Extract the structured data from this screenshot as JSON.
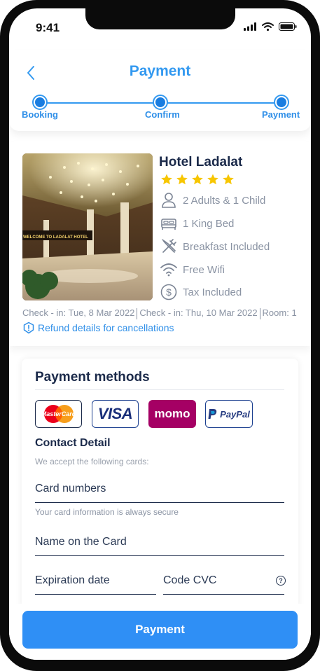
{
  "status_bar": {
    "time": "9:41"
  },
  "header": {
    "title": "Payment"
  },
  "steps": [
    {
      "label": "Booking"
    },
    {
      "label": "Confirm"
    },
    {
      "label": "Payment"
    }
  ],
  "hotel": {
    "name": "Hotel Ladalat",
    "rating": 5,
    "photo_sign": "WELCOME TO LADALAT HOTEL",
    "amenities": {
      "guests": "2 Adults & 1 Child",
      "bed": "1 King Bed",
      "breakfast": "Breakfast Included",
      "wifi": "Free Wifi",
      "tax": "Tax Included"
    },
    "check_in": "Check - in: Tue, 8 Mar 2022",
    "check_out": "Check - in: Thu, 10 Mar 2022",
    "room": "Room: 1",
    "refund_link": "Refund details for cancellations"
  },
  "payment_methods": {
    "title": "Payment methods",
    "options": [
      {
        "name": "MasterCard"
      },
      {
        "name": "VISA"
      },
      {
        "name": "momo"
      },
      {
        "name": "PayPal"
      }
    ]
  },
  "contact": {
    "title": "Contact Detail",
    "subtitle": "We accept the following cards:",
    "card_number_label": "Card numbers",
    "card_hint": "Your card information is always secure",
    "name_label": "Name on the Card",
    "expiration_label": "Expiration date",
    "cvc_label": "Code CVC"
  },
  "submit": {
    "label": "Payment"
  },
  "colors": {
    "accent": "#2f8ff5",
    "title": "#1b2a4a",
    "muted": "#8a93a3",
    "star": "#f7c600",
    "momo": "#a50064"
  }
}
